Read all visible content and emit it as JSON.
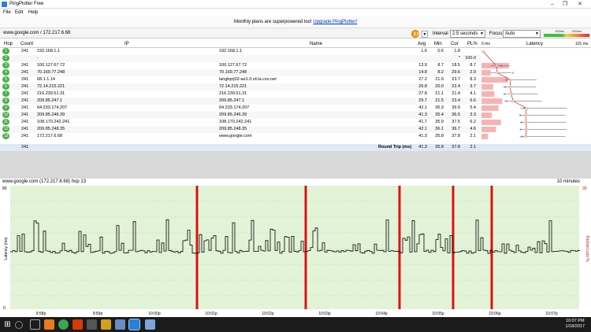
{
  "window": {
    "title": "PingPlotter Free",
    "minimize": "–",
    "restore": "❐",
    "close": "✕"
  },
  "menu": [
    "File",
    "Edit",
    "Help"
  ],
  "banner": {
    "text": "Monthly plans are superpowered too! ",
    "link": "Upgrade PingPlotter!"
  },
  "toolbar": {
    "target": "www.google.com / 172.217.6.68",
    "interval_label": "Interval",
    "interval_value": "2.5 seconds",
    "focus_label": "Focus",
    "focus_value": "Auto",
    "scale_100": "100ms",
    "scale_200": "200ms"
  },
  "columns": {
    "hop": "Hop",
    "count": "Count",
    "ip": "IP",
    "name": "Name",
    "avg": "Avg",
    "min": "Min",
    "cur": "Cur",
    "pl": "PL%",
    "zero": "0 ms",
    "latency": "Latency",
    "max": "101 ms"
  },
  "hops": [
    {
      "hop": "1",
      "count": "241",
      "ip": "192.168.1.1",
      "name": "192.168.1.1",
      "avg": "1.6",
      "min": "0.6",
      "cur": "1.8",
      "pl": ""
    },
    {
      "hop": "2",
      "count": "",
      "ip": "-",
      "name": "",
      "avg": "",
      "min": "",
      "cur": "*",
      "pl": "100.0"
    },
    {
      "hop": "3",
      "count": "241",
      "ip": "100.127.67.72",
      "name": "100.127.67.72",
      "avg": "13.9",
      "min": "8.7",
      "cur": "18.5",
      "pl": "8.7"
    },
    {
      "hop": "4",
      "count": "241",
      "ip": "70.169.77.248",
      "name": "70.169.77.248",
      "avg": "14.8",
      "min": "8.2",
      "cur": "29.6",
      "pl": "2.9"
    },
    {
      "hop": "5",
      "count": "241",
      "ip": "68.1.1.14",
      "name": "langbprj02-ae1.0.rd.la.cox.net",
      "avg": "27.2",
      "min": "21.9",
      "cur": "23.7",
      "pl": "8.3"
    },
    {
      "hop": "6",
      "count": "241",
      "ip": "72.14.215.221",
      "name": "72.14.215.221",
      "avg": "26.8",
      "min": "20.0",
      "cur": "22.4",
      "pl": "3.7"
    },
    {
      "hop": "7",
      "count": "241",
      "ip": "216.239.51.31",
      "name": "216.239.51.31",
      "avg": "27.8",
      "min": "21.1",
      "cur": "21.4",
      "pl": "4.1"
    },
    {
      "hop": "8",
      "count": "241",
      "ip": "209.85.247.1",
      "name": "209.85.247.1",
      "avg": "29.7",
      "min": "21.5",
      "cur": "23.4",
      "pl": "6.6"
    },
    {
      "hop": "9",
      "count": "241",
      "ip": "64.233.174.207",
      "name": "64.233.174.207",
      "avg": "42.1",
      "min": "36.3",
      "cur": "39.9",
      "pl": "5.4"
    },
    {
      "hop": "10",
      "count": "241",
      "ip": "209.85.246.39",
      "name": "209.85.246.39",
      "avg": "41.3",
      "min": "35.4",
      "cur": "36.5",
      "pl": "3.3"
    },
    {
      "hop": "11",
      "count": "241",
      "ip": "108.170.242.241",
      "name": "108.170.242.241",
      "avg": "41.7",
      "min": "35.9",
      "cur": "37.5",
      "pl": "6.2"
    },
    {
      "hop": "12",
      "count": "241",
      "ip": "209.85.248.35",
      "name": "209.85.248.35",
      "avg": "42.1",
      "min": "36.1",
      "cur": "36.7",
      "pl": "4.6"
    },
    {
      "hop": "13",
      "count": "241",
      "ip": "172.217.6.68",
      "name": "www.google.com",
      "avg": "41.3",
      "min": "35.8",
      "cur": "37.8",
      "pl": "2.1"
    }
  ],
  "summary": {
    "count": "241",
    "label": "Round Trip (ms)",
    "avg": "41.3",
    "min": "35.8",
    "cur": "37.8",
    "pl": "2.1"
  },
  "graph": {
    "title": "www.google.com (172.217.6.68) hop 13",
    "duration": "10 minutes",
    "y_max": "80",
    "y_min": "0",
    "pl_max": "30",
    "y_label": "Latency (ms)",
    "pl_label": "Packet Loss %",
    "x_labels": [
      "9:58p",
      "9:59p",
      "10:00p",
      "10:01p",
      "10:02p",
      "10:03p",
      "10:04p",
      "10:05p",
      "10:06p",
      "10:07p"
    ]
  },
  "clock": {
    "time": "10:07 PM",
    "date": "1/18/2017"
  },
  "colors": {
    "green_bg": "#e2f3d8",
    "loss": "#e01010",
    "bar": "#f7b3b3"
  }
}
